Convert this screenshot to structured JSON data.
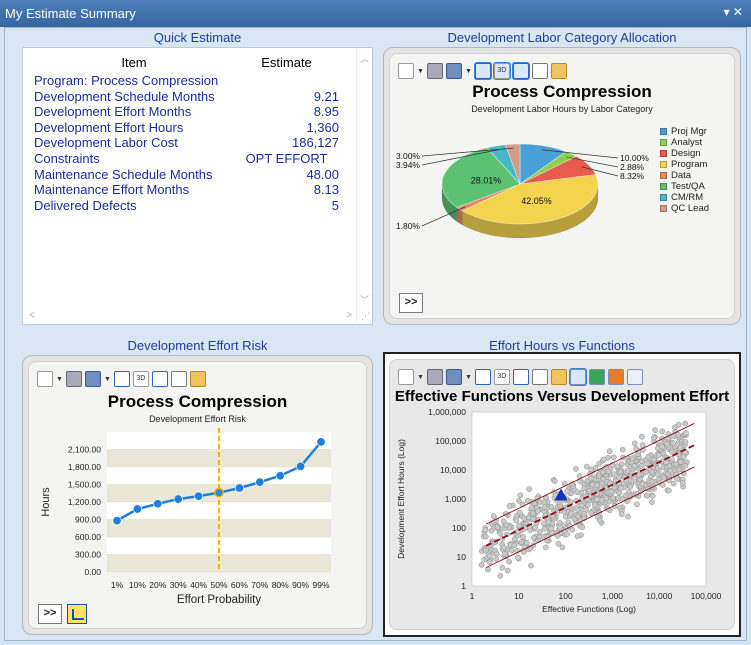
{
  "window": {
    "title": "My Estimate Summary",
    "controls": "▾ ✕"
  },
  "quick_estimate": {
    "panel_title": "Quick Estimate",
    "columns": [
      "Item",
      "Estimate"
    ],
    "rows": [
      [
        "Program: Process Compression",
        ""
      ],
      [
        "Development Schedule Months",
        "9.21"
      ],
      [
        "Development Effort Months",
        "8.95"
      ],
      [
        "Development Effort Hours",
        "1,360"
      ],
      [
        "Development Labor Cost",
        "186,127"
      ],
      [
        "Constraints",
        "OPT EFFORT"
      ],
      [
        "Maintenance Schedule Months",
        "48.00"
      ],
      [
        "Maintenance Effort Months",
        "8.13"
      ],
      [
        "Delivered Defects",
        "5"
      ]
    ]
  },
  "labor_allocation": {
    "panel_title": "Development Labor Category Allocation",
    "chart_title": "Process Compression",
    "chart_subtitle": "Development Labor Hours by Labor Category",
    "more_button": ">>",
    "colors": {
      "accent": "#1a4fa8"
    }
  },
  "effort_risk": {
    "panel_title": "Development Effort Risk",
    "chart_title": "Process Compression",
    "chart_subtitle": "Development Effort Risk",
    "more_button": ">>"
  },
  "effort_vs_functions": {
    "panel_title": "Effort Hours vs Functions",
    "chart_title": "Effective Functions Versus Development Effort"
  },
  "chart_data": [
    {
      "type": "pie",
      "categories": [
        "Proj Mgr",
        "Analyst",
        "Design",
        "Program",
        "Data",
        "Test/QA",
        "CM/RM",
        "QC Lead"
      ],
      "values": [
        10.0,
        2.88,
        8.32,
        42.05,
        1.8,
        28.01,
        3.94,
        3.0
      ],
      "labels": [
        "10.00%",
        "2.88%",
        "8.32%",
        "42.05%",
        "1.80%",
        "28.01%",
        "3.94%",
        "3.00%"
      ],
      "colors": [
        "#4a9fd6",
        "#8fcf4f",
        "#e95b4d",
        "#f4d44e",
        "#e58a63",
        "#5cc272",
        "#48b8c8",
        "#d49a8a"
      ],
      "legend": "right"
    },
    {
      "type": "line",
      "x": [
        "1%",
        "10%",
        "20%",
        "30%",
        "40%",
        "50%",
        "60%",
        "70%",
        "80%",
        "90%",
        "99%"
      ],
      "values": [
        880,
        1080,
        1170,
        1250,
        1300,
        1360,
        1440,
        1540,
        1650,
        1810,
        2230
      ],
      "xlabel": "Effort Probability",
      "ylabel": "Hours",
      "yticks": [
        "0.00",
        "300.00",
        "600.00",
        "900.00",
        "1,200.00",
        "1,500.00",
        "1,800.00",
        "2,100.00"
      ],
      "ylim": [
        0,
        2400
      ],
      "marker_at": "50%",
      "grid": true
    },
    {
      "type": "scatter",
      "xlabel": "Effective Functions (Log)",
      "ylabel": "Development Effort Hours (Log)",
      "xticks": [
        "1",
        "10",
        "100",
        "1,000",
        "10,000",
        "100,000"
      ],
      "yticks": [
        "1",
        "10",
        "100",
        "1,000",
        "10,000",
        "100,000",
        "1,000,000"
      ],
      "xscale": "log",
      "yscale": "log",
      "highlight_point": {
        "x": 80,
        "y": 1360
      },
      "grid": true
    }
  ]
}
